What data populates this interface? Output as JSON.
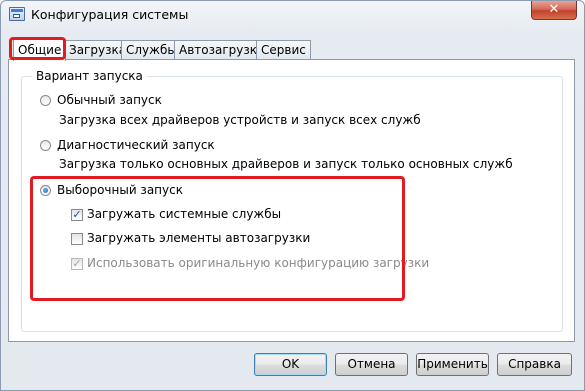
{
  "window": {
    "title": "Конфигурация системы",
    "close_glyph": "✕"
  },
  "tabs": [
    {
      "label": "Общие"
    },
    {
      "label": "Загрузка"
    },
    {
      "label": "Службы"
    },
    {
      "label": "Автозагрузка"
    },
    {
      "label": "Сервис"
    }
  ],
  "active_tab": "Общие",
  "group": {
    "legend": "Вариант запуска"
  },
  "options": {
    "normal": {
      "label": "Обычный запуск",
      "description": "Загрузка всех драйверов устройств и запуск всех служб",
      "selected": false
    },
    "diagnostic": {
      "label": "Диагностический запуск",
      "description": "Загрузка только основных драйверов и запуск только основных служб",
      "selected": false
    },
    "selective": {
      "label": "Выборочный запуск",
      "selected": true
    }
  },
  "checkboxes": {
    "system_services": {
      "label": "Загружать системные службы",
      "checked": true,
      "enabled": true,
      "mark": "✓"
    },
    "startup_items": {
      "label": "Загружать элементы автозагрузки",
      "checked": false,
      "enabled": true,
      "mark": ""
    },
    "original_boot": {
      "label": "Использовать оригинальную конфигурацию загрузки",
      "checked": true,
      "enabled": false,
      "mark": "✓"
    }
  },
  "buttons": {
    "ok": "OK",
    "cancel": "Отмена",
    "apply": "Применить",
    "help": "Справка"
  },
  "colors": {
    "highlight": "#e11b22",
    "title_close": "#c4402b"
  }
}
